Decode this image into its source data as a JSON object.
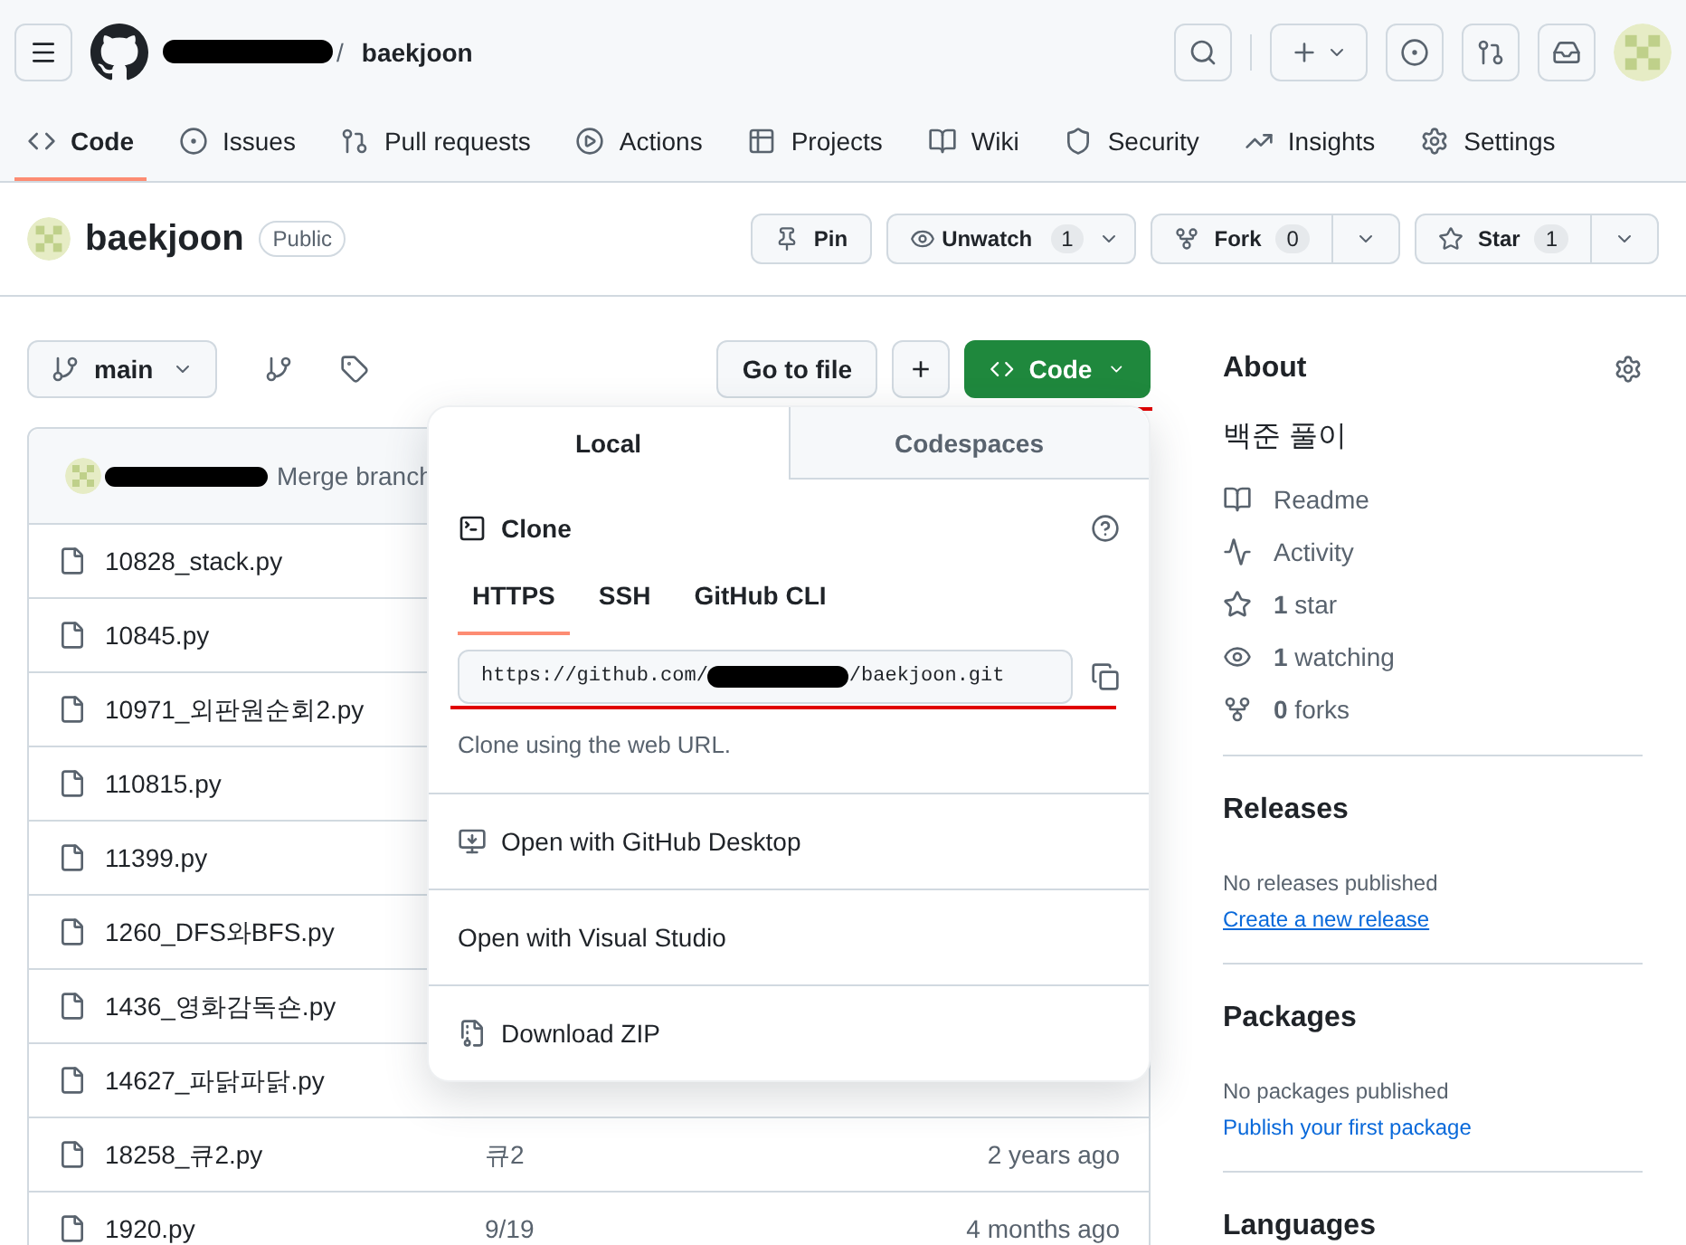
{
  "header": {
    "separator": "/",
    "repo": "baekjoon"
  },
  "nav_tabs": [
    {
      "label": "Code",
      "selected": true
    },
    {
      "label": "Issues",
      "selected": false
    },
    {
      "label": "Pull requests",
      "selected": false
    },
    {
      "label": "Actions",
      "selected": false
    },
    {
      "label": "Projects",
      "selected": false
    },
    {
      "label": "Wiki",
      "selected": false
    },
    {
      "label": "Security",
      "selected": false
    },
    {
      "label": "Insights",
      "selected": false
    },
    {
      "label": "Settings",
      "selected": false
    }
  ],
  "repo_header": {
    "name": "baekjoon",
    "visibility": "Public",
    "pin": "Pin",
    "watch": {
      "label": "Unwatch",
      "count": "1"
    },
    "fork": {
      "label": "Fork",
      "count": "0"
    },
    "star": {
      "label": "Star",
      "count": "1"
    }
  },
  "toolbar": {
    "branch": "main",
    "go_to_file": "Go to file",
    "add": "+",
    "code": "Code"
  },
  "commit": {
    "message": "Merge branch"
  },
  "files": [
    {
      "name": "10828_stack.py"
    },
    {
      "name": "10845.py"
    },
    {
      "name": "10971_외판원순회2.py"
    },
    {
      "name": "110815.py"
    },
    {
      "name": "11399.py"
    },
    {
      "name": "1260_DFS와BFS.py"
    },
    {
      "name": "1436_영화감독숀.py"
    },
    {
      "name": "14627_파닭파닭.py"
    },
    {
      "name": "18258_큐2.py",
      "message": "큐2",
      "time": "2 years ago"
    },
    {
      "name": "1920.py",
      "message": "9/19",
      "time": "4 months ago"
    }
  ],
  "clone_popup": {
    "tabs": [
      {
        "label": "Local",
        "selected": true
      },
      {
        "label": "Codespaces",
        "selected": false
      }
    ],
    "title": "Clone",
    "protocols": [
      {
        "label": "HTTPS",
        "selected": true
      },
      {
        "label": "SSH",
        "selected": false
      },
      {
        "label": "GitHub CLI",
        "selected": false
      }
    ],
    "url_start": "https://github.com/",
    "url_end": "/baekjoon.git",
    "hint": "Clone using the web URL.",
    "actions": [
      {
        "kind": "desktop",
        "label": "Open with GitHub Desktop"
      },
      {
        "kind": "plain",
        "label": "Open with Visual Studio"
      },
      {
        "kind": "zip",
        "label": "Download ZIP"
      }
    ]
  },
  "about": {
    "title": "About",
    "description": "백준 풀이",
    "links": [
      {
        "kind": "readme",
        "text": "Readme"
      },
      {
        "kind": "activity",
        "text": "Activity"
      },
      {
        "kind": "star",
        "text": "**1** star"
      },
      {
        "kind": "watch",
        "text": "**1** watching"
      },
      {
        "kind": "fork",
        "text": "**0** forks"
      }
    ]
  },
  "releases": {
    "title": "Releases",
    "note": "No releases published",
    "link": "Create a new release"
  },
  "packages": {
    "title": "Packages",
    "note": "No packages published",
    "link": "Publish your first package"
  },
  "languages": {
    "title": "Languages"
  }
}
